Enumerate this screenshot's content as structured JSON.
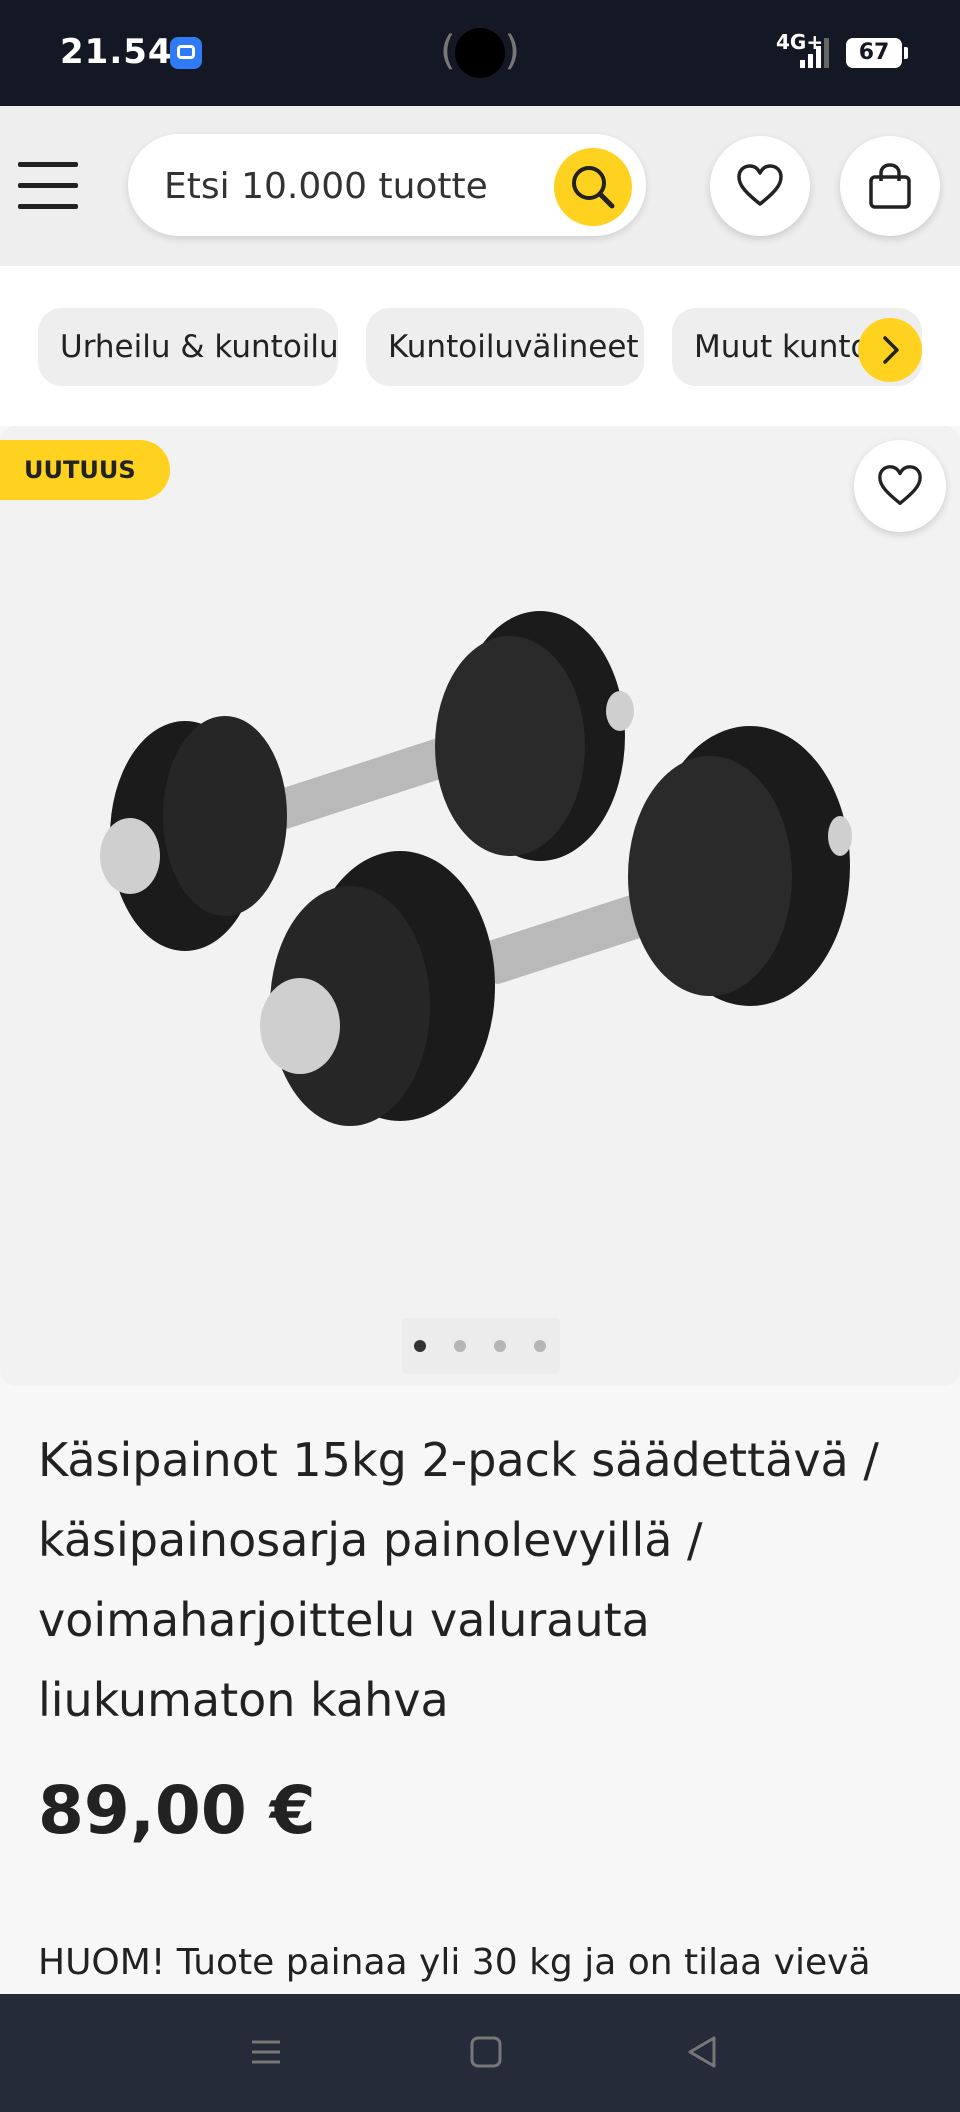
{
  "status_bar": {
    "time": "21.54",
    "network": "4G+",
    "battery": "67"
  },
  "header": {
    "search_placeholder": "Etsi 10.000 tuotte"
  },
  "categories": [
    {
      "label": "Urheilu & kuntoilu"
    },
    {
      "label": "Kuntoiluvälineet"
    },
    {
      "label": "Muut kuntoi"
    }
  ],
  "product": {
    "badge": "UUTUUS",
    "image_count": 4,
    "active_image": 1,
    "title": "Käsipainot 15kg 2-pack säädettävä / käsipainosarja painolevyillä / voimaharjoittelu valurauta liukumaton kahva",
    "price": "89,00 €",
    "note": "HUOM! Tuote painaa yli 30 kg ja on tilaa vievä"
  },
  "colors": {
    "accent": "#ffd21f",
    "status_bar": "#141824",
    "nav_bar": "#252b39"
  }
}
